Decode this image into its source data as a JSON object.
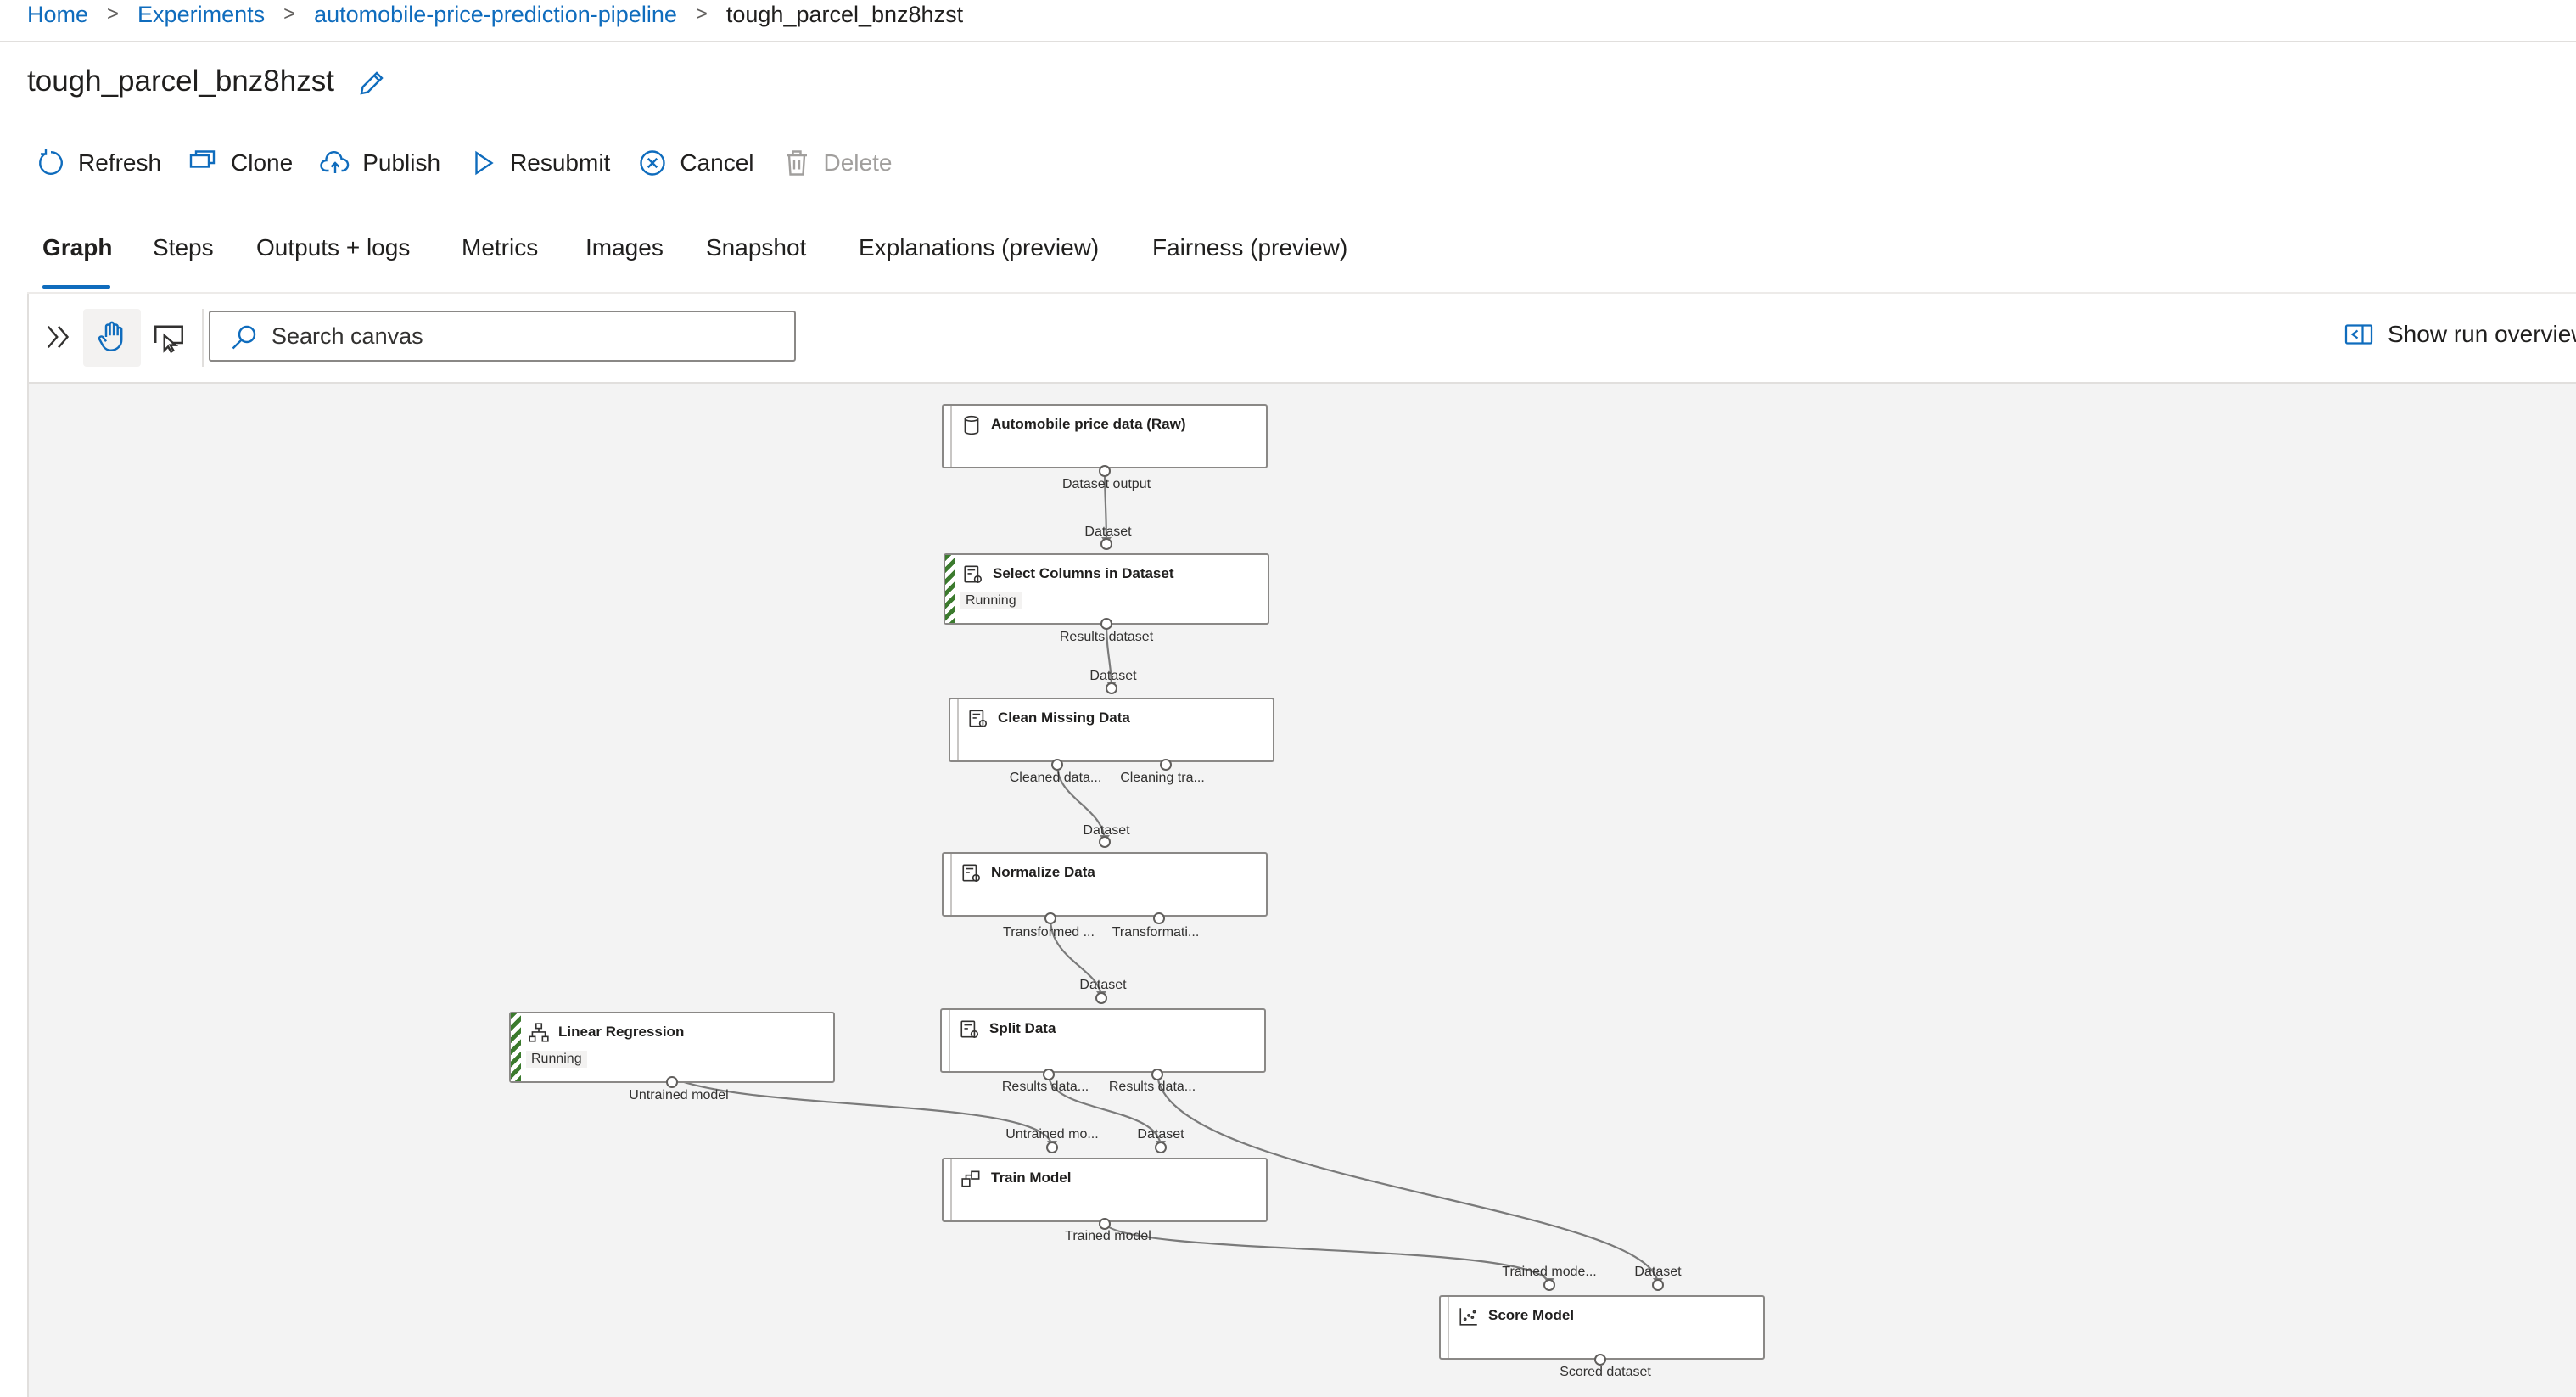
{
  "breadcrumb": {
    "items": [
      "Home",
      "Experiments",
      "automobile-price-prediction-pipeline"
    ],
    "current": "tough_parcel_bnz8hzst",
    "separator": ">"
  },
  "page": {
    "title": "tough_parcel_bnz8hzst"
  },
  "toolbar": {
    "refresh": "Refresh",
    "clone": "Clone",
    "publish": "Publish",
    "resubmit": "Resubmit",
    "cancel": "Cancel",
    "delete": "Delete"
  },
  "tabs": [
    "Graph",
    "Steps",
    "Outputs + logs",
    "Metrics",
    "Images",
    "Snapshot",
    "Explanations (preview)",
    "Fairness (preview)"
  ],
  "active_tab": "Graph",
  "canvas_toolbar": {
    "search_placeholder": "Search canvas",
    "show_run_overview": "Show run overview"
  },
  "graph": {
    "nodes": {
      "raw": {
        "title": "Automobile price data (Raw)",
        "output": "Dataset output"
      },
      "select": {
        "title": "Select Columns in Dataset",
        "status": "Running",
        "input": "Dataset",
        "output": "Results dataset"
      },
      "clean": {
        "title": "Clean Missing Data",
        "input": "Dataset",
        "output1": "Cleaned data...",
        "output2": "Cleaning tra..."
      },
      "normalize": {
        "title": "Normalize Data",
        "input": "Dataset",
        "output1": "Transformed ...",
        "output2": "Transformati..."
      },
      "split": {
        "title": "Split Data",
        "input": "Dataset",
        "output1": "Results data...",
        "output2": "Results data..."
      },
      "linreg": {
        "title": "Linear Regression",
        "status": "Running",
        "output": "Untrained model"
      },
      "train": {
        "title": "Train Model",
        "input1": "Untrained mo...",
        "input2": "Dataset",
        "output": "Trained model"
      },
      "score": {
        "title": "Score Model",
        "input1": "Trained mode...",
        "input2": "Dataset",
        "output": "Scored dataset"
      }
    }
  },
  "colors": {
    "accent": "#0f6cbd",
    "running_stripe": "#3b7a2d",
    "canvas_bg": "#f3f3f3"
  }
}
